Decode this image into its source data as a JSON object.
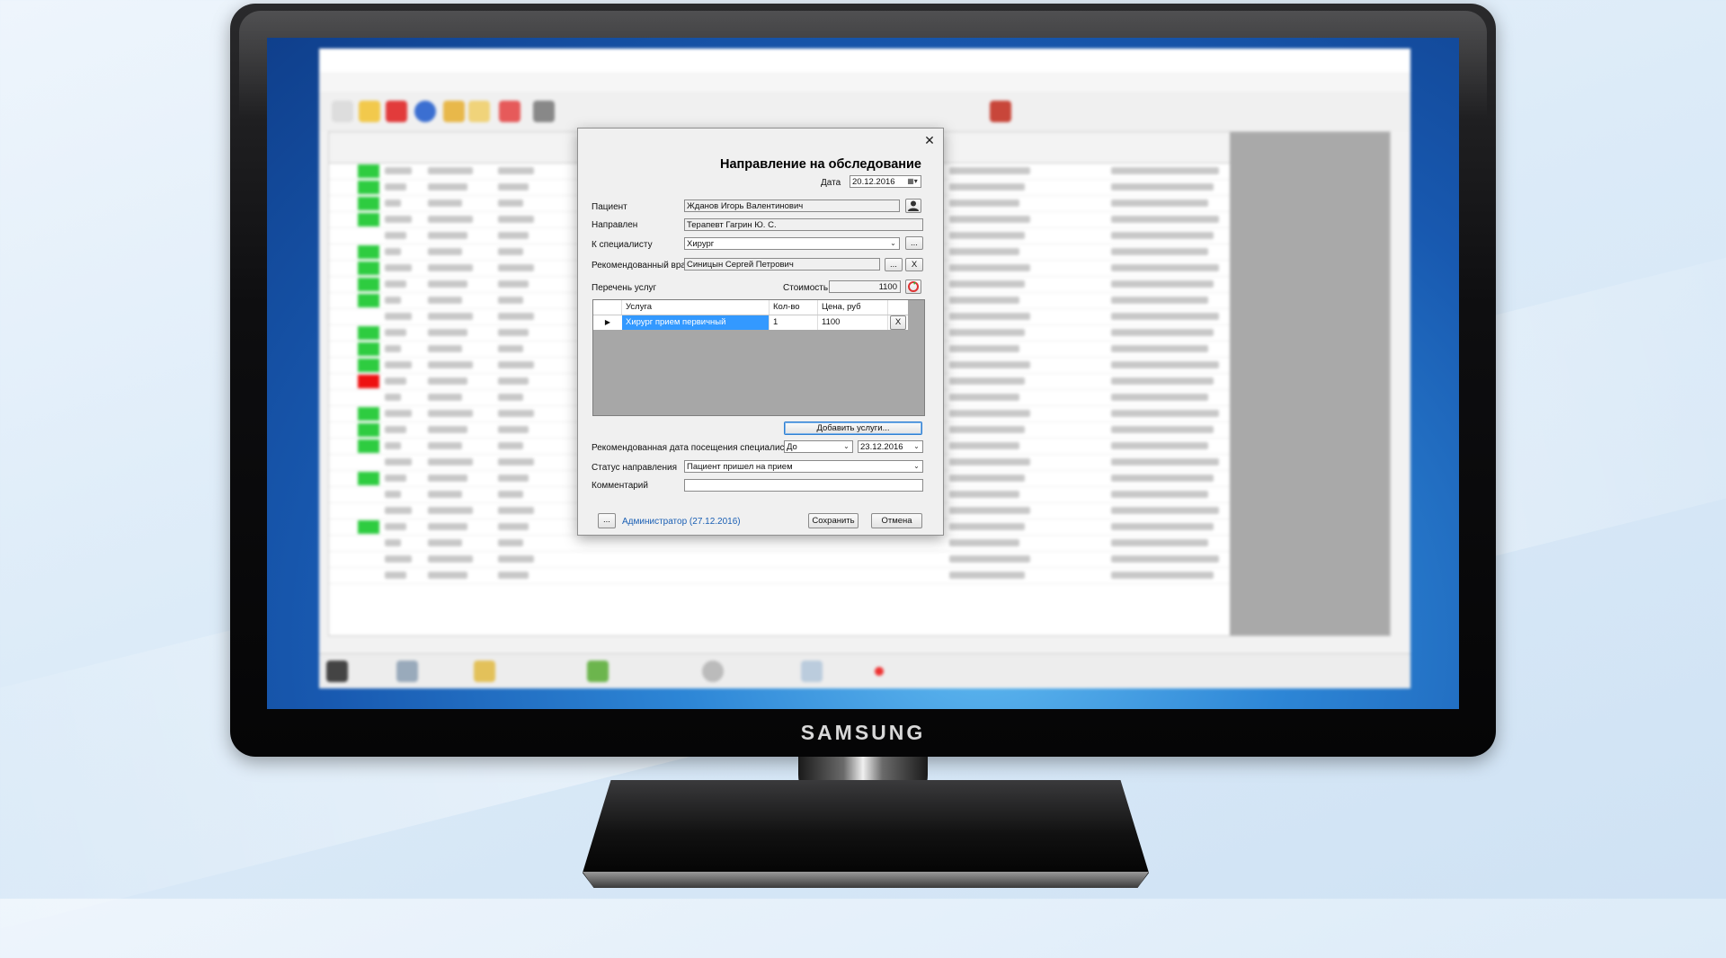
{
  "dialog": {
    "title": "Направление на обследование",
    "date_label": "Дата",
    "date_value": "20.12.2016",
    "patient_label": "Пациент",
    "patient_value": "Жданов Игорь Валентинович",
    "referred_label": "Направлен",
    "referred_value": "Терапевт Гагрин Ю. С.",
    "specialist_label": "К специалисту",
    "specialist_value": "Хирург",
    "recommended_doctor_label": "Рекомендованный врач",
    "recommended_doctor_value": "Синицын Сергей Петрович",
    "services_label": "Перечень услуг",
    "cost_label": "Стоимость",
    "cost_value": "1100",
    "table": {
      "columns": [
        "Услуга",
        "Кол-во",
        "Цена, руб"
      ],
      "rows": [
        {
          "service": "Хирург прием первичный",
          "qty": "1",
          "price": "1100",
          "remove": "X"
        }
      ]
    },
    "add_services_label": "Добавить услуги...",
    "visit_date_label": "Рекомендованная дата посещения специалиста",
    "visit_date_mode": "До",
    "visit_date_value": "23.12.2016",
    "status_label": "Статус направления",
    "status_value": "Пациент пришел на прием",
    "comment_label": "Комментарий",
    "comment_value": "",
    "author_link": "Администратор (27.12.2016)",
    "ellipsis": "...",
    "clear": "X",
    "save_label": "Сохранить",
    "cancel_label": "Отмена"
  },
  "monitor": {
    "brand": "SAMSUNG"
  }
}
